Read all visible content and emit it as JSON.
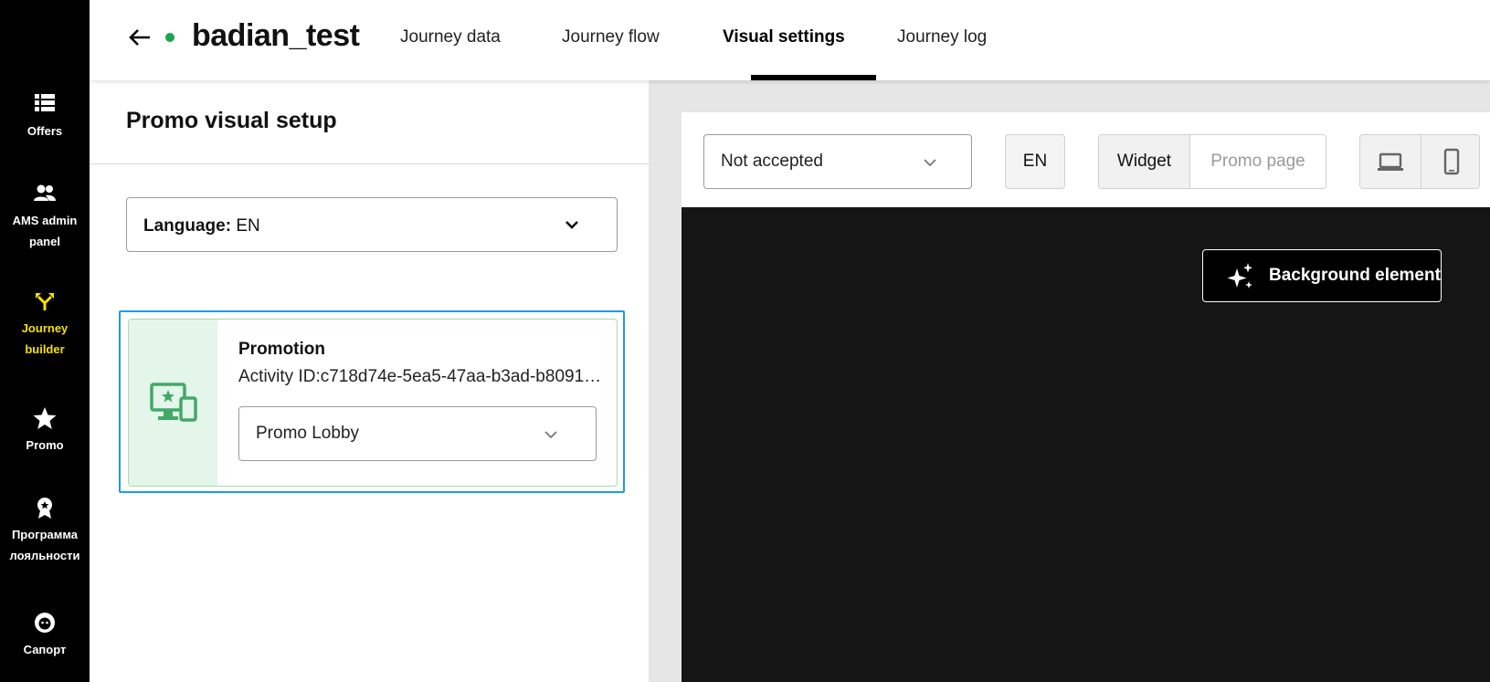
{
  "nav": {
    "items": [
      {
        "label": "Offers",
        "icon": "list-icon"
      },
      {
        "label": "AMS admin\npanel",
        "icon": "users-icon"
      },
      {
        "label": "Journey\nbuilder",
        "icon": "branch-icon",
        "active": true
      },
      {
        "label": "Promo",
        "icon": "star-icon"
      },
      {
        "label": "Программа\nлояльности",
        "icon": "award-icon"
      },
      {
        "label": "Сапорт",
        "icon": "support-icon"
      }
    ],
    "active_color": "#f5e000"
  },
  "header": {
    "title": "badian_test",
    "status_color": "#1aa64a",
    "tabs": [
      {
        "label": "Journey data"
      },
      {
        "label": "Journey flow"
      },
      {
        "label": "Visual settings",
        "active": true
      },
      {
        "label": "Journey log"
      }
    ]
  },
  "left_panel": {
    "title": "Promo visual setup",
    "language_label": "Language:",
    "language_value": "EN",
    "promotion": {
      "name": "Promotion",
      "activity_id": "Activity ID:c718d74e-5ea5-47aa-b3ad-b8091…",
      "template": "Promo Lobby"
    }
  },
  "preview": {
    "status": "Not accepted",
    "language": "EN",
    "view_modes": [
      "Widget",
      "Promo page"
    ],
    "active_view": "Widget",
    "devices": [
      "desktop-icon",
      "mobile-icon"
    ],
    "background_button": "Background element"
  }
}
